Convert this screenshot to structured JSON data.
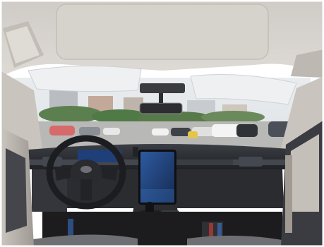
{
  "photo": {
    "subject": "car interior",
    "colors": {
      "headliner": "#d9d6d1",
      "headliner_shadow": "#b8b4ae",
      "pillar": "#c9c4bd",
      "sky": "#e8ebee",
      "dashboard": "#2a2c30",
      "dash_dark": "#1a1b1e",
      "screen": "#1f3b6e",
      "screen_glow": "#3a6fb8",
      "trees": "#4f7a45",
      "plastic_wrap": "#eef0f2",
      "door_panel": "#3a3c41",
      "floor": "#1c1c1e",
      "accent_red": "#c23a3a",
      "accent_blue": "#3a6ec2"
    }
  }
}
